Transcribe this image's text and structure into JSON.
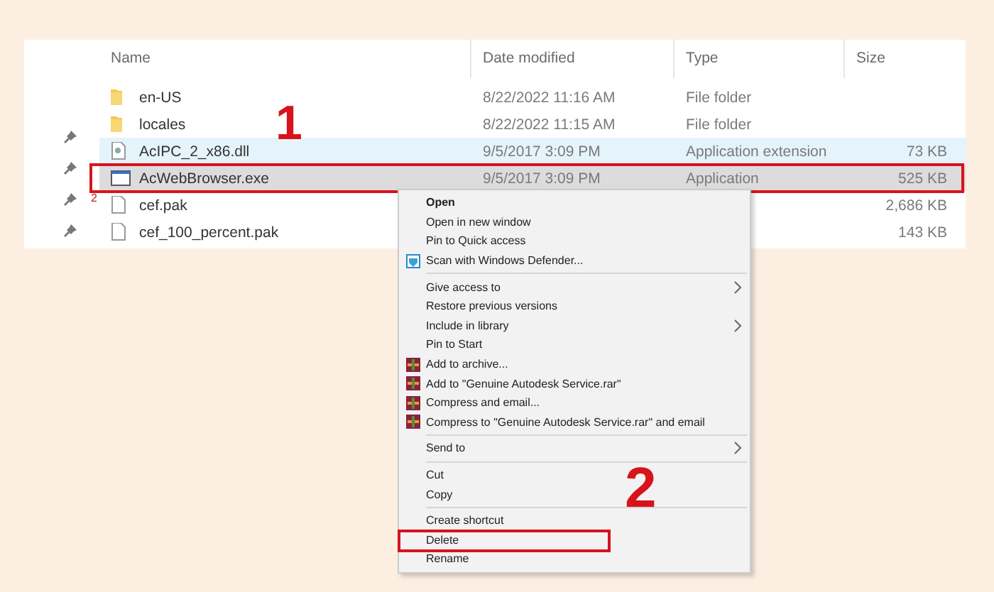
{
  "explorer": {
    "columns": [
      "Name",
      "Date modified",
      "Type",
      "Size"
    ],
    "nav_pane": {
      "label": "2"
    },
    "files": [
      {
        "kind": "folder",
        "name": "en-US",
        "date": "8/22/2022 11:16 AM",
        "type": "File folder",
        "hovered": false,
        "selected": false,
        "outlined": false
      },
      {
        "kind": "folder",
        "name": "locales",
        "date": "8/22/2022 11:15 AM",
        "type": "File folder",
        "hovered": false,
        "selected": false,
        "outlined": false
      },
      {
        "kind": "dll",
        "name": "AcIPC_2_x86.dll",
        "date": "9/5/2017 3:09 PM",
        "type": "Application extension",
        "size": "73 KB",
        "hovered": true,
        "selected": false,
        "outlined": false
      },
      {
        "kind": "exe",
        "name": "AcWebBrowser.exe",
        "date": "9/5/2017 3:09 PM",
        "type": "Application",
        "size": "525 KB",
        "hovered": false,
        "selected": true,
        "outlined": true
      },
      {
        "kind": "file",
        "name": "cef.pak",
        "size": "2,686 KB",
        "hovered": false,
        "selected": false,
        "outlined": false
      },
      {
        "kind": "file",
        "name": "cef_100_percent.pak",
        "size": "143 KB",
        "hovered": false,
        "selected": false,
        "outlined": false
      }
    ]
  },
  "context_menu": {
    "items": [
      {
        "kind": "item",
        "label": "Open",
        "default": true
      },
      {
        "kind": "item",
        "label": "Open in new window"
      },
      {
        "kind": "item",
        "label": "Pin to Quick access"
      },
      {
        "kind": "scan",
        "label": "Scan with Windows Defender..."
      },
      {
        "kind": "separator"
      },
      {
        "kind": "item",
        "label": "Give access to",
        "submenu": true
      },
      {
        "kind": "item",
        "label": "Restore previous versions"
      },
      {
        "kind": "item",
        "label": "Include in library",
        "submenu": true
      },
      {
        "kind": "item",
        "label": "Pin to Start"
      },
      {
        "kind": "archive",
        "label": "Add to archive..."
      },
      {
        "kind": "archive",
        "label": "Add to \"Genuine Autodesk Service.rar\""
      },
      {
        "kind": "archive",
        "label": "Compress and email..."
      },
      {
        "kind": "archive",
        "label": "Compress to \"Genuine Autodesk Service.rar\" and email"
      },
      {
        "kind": "separator"
      },
      {
        "kind": "item",
        "label": "Send to",
        "submenu": true
      },
      {
        "kind": "separator"
      },
      {
        "kind": "item",
        "label": "Cut"
      },
      {
        "kind": "item",
        "label": "Copy"
      },
      {
        "kind": "separator"
      },
      {
        "kind": "item",
        "label": "Create shortcut"
      },
      {
        "kind": "item",
        "label": "Delete",
        "outlined": true
      },
      {
        "kind": "item",
        "label": "Rename"
      }
    ]
  },
  "step_labels": [
    {
      "kind": "file",
      "text": "1"
    },
    {
      "kind": "menu",
      "text": "2"
    }
  ]
}
